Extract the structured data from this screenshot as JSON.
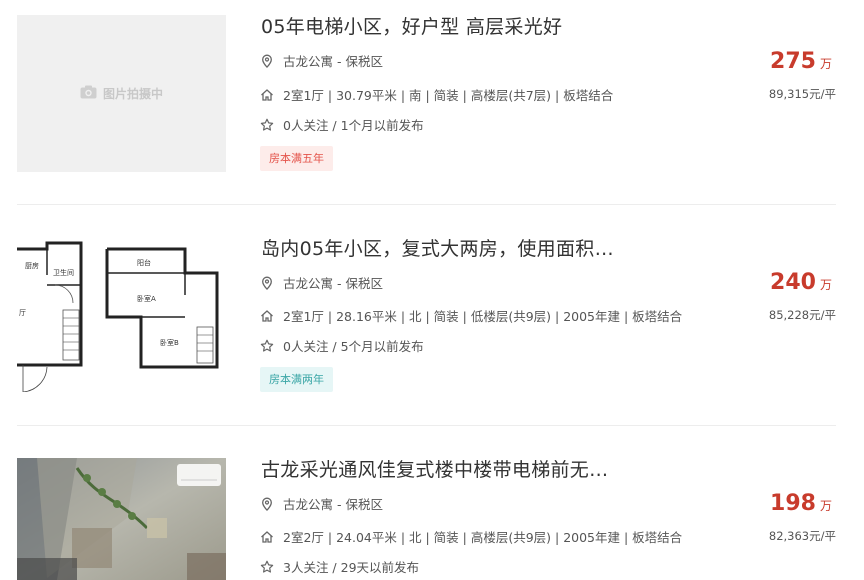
{
  "listings": [
    {
      "title": "05年电梯小区，好户型 高层采光好",
      "location": "古龙公寓 - 保税区",
      "details": "2室1厅 | 30.79平米 | 南 | 简装 | 高楼层(共7层) | 板塔结合",
      "follow": "0人关注 / 1个月以前发布",
      "tag": "房本满五年",
      "price": "275",
      "price_unit": "万",
      "unit_price": "89,315元/平",
      "image_placeholder": "图片拍摄中"
    },
    {
      "title": "岛内05年小区，复式大两房，使用面积…",
      "location": "古龙公寓 - 保税区",
      "details": "2室1厅 | 28.16平米 | 北 | 简装 | 低楼层(共9层) | 2005年建 | 板塔结合",
      "follow": "0人关注 / 5个月以前发布",
      "tag": "房本满两年",
      "price": "240",
      "price_unit": "万",
      "unit_price": "85,228元/平",
      "floorplan_labels": [
        "厨房",
        "卫生间",
        "厅",
        "阳台",
        "卧室A",
        "卧室B"
      ]
    },
    {
      "title": "古龙采光通风佳复式楼中楼带电梯前无…",
      "location": "古龙公寓 - 保税区",
      "details": "2室2厅 | 24.04平米 | 北 | 简装 | 高楼层(共9层) | 2005年建 | 板塔结合",
      "follow": "3人关注 / 29天以前发布",
      "price": "198",
      "price_unit": "万",
      "unit_price": "82,363元/平"
    }
  ],
  "icons": [
    "location-icon",
    "house-icon",
    "star-icon",
    "camera-icon"
  ],
  "colors": {
    "price": "#c83b2c",
    "tag_red_bg": "#fdecea",
    "tag_red_text": "#e4534a",
    "tag_teal_bg": "#e6f6f6",
    "tag_teal_text": "#3aa6a6"
  }
}
